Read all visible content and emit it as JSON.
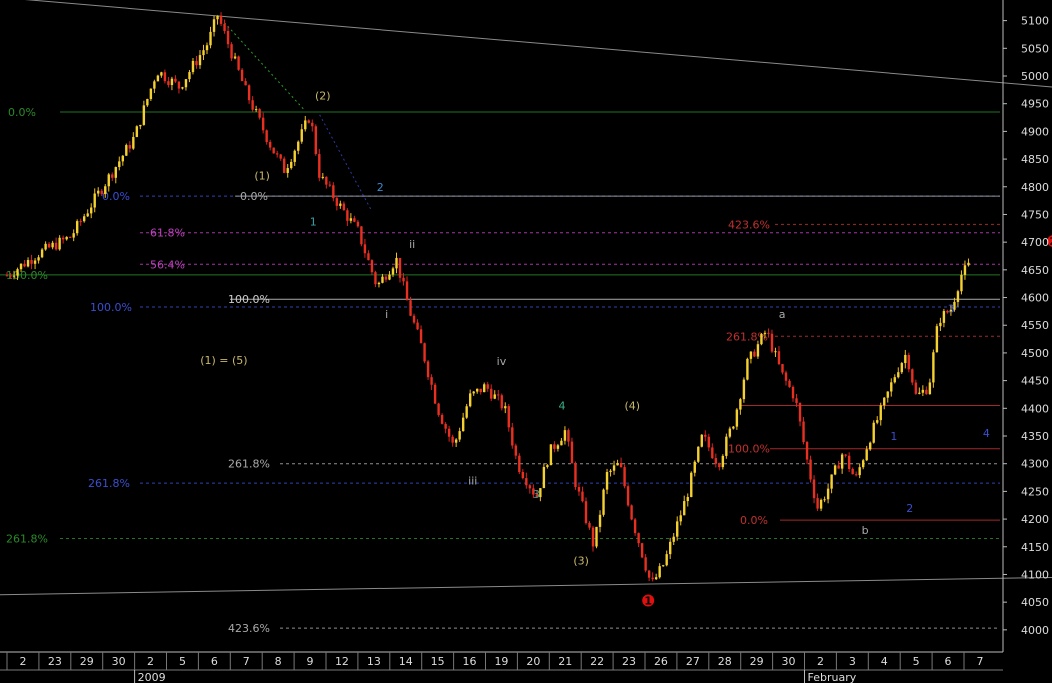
{
  "chart_data": {
    "type": "candlestick",
    "yaxis": {
      "ylim": [
        3960,
        5130
      ],
      "ticks": [
        4000,
        4050,
        4100,
        4150,
        4200,
        4250,
        4300,
        4350,
        4400,
        4450,
        4500,
        4550,
        4600,
        4650,
        4700,
        4750,
        4800,
        4850,
        4900,
        4950,
        5000,
        5050,
        5100
      ],
      "tick_labels": [
        "4000",
        "4050",
        "4100",
        "4150",
        "4200",
        "4250",
        "4300",
        "4350",
        "4400",
        "4450",
        "4500",
        "4550",
        "4600",
        "4650",
        "4700",
        "4750",
        "4800",
        "4850",
        "4900",
        "4950",
        "5000",
        "5050",
        "5100"
      ]
    },
    "xaxis": {
      "days": [
        "2",
        "23",
        "29",
        "30",
        "2",
        "5",
        "6",
        "7",
        "8",
        "9",
        "12",
        "13",
        "14",
        "15",
        "16",
        "19",
        "20",
        "21",
        "22",
        "23",
        "26",
        "27",
        "28",
        "29",
        "30",
        "2",
        "3",
        "4",
        "5",
        "6",
        "7"
      ],
      "months": [
        "2009",
        "February"
      ],
      "month_start_day_index": [
        4,
        25
      ]
    },
    "price_path": [
      [
        0,
        4640
      ],
      [
        1,
        4680
      ],
      [
        2,
        4710
      ],
      [
        3,
        4800
      ],
      [
        4,
        4890
      ],
      [
        4.7,
        5010
      ],
      [
        5.4,
        4980
      ],
      [
        6.3,
        5060
      ],
      [
        6.6,
        5110
      ],
      [
        7.5,
        4970
      ],
      [
        8.3,
        4870
      ],
      [
        8.7,
        4830
      ],
      [
        9.2,
        4890
      ],
      [
        9.5,
        4930
      ],
      [
        9.8,
        4820
      ],
      [
        10.5,
        4760
      ],
      [
        11,
        4720
      ],
      [
        11.6,
        4620
      ],
      [
        12.2,
        4670
      ],
      [
        12.6,
        4580
      ],
      [
        13,
        4510
      ],
      [
        13.5,
        4400
      ],
      [
        14,
        4330
      ],
      [
        14.5,
        4420
      ],
      [
        15,
        4440
      ],
      [
        15.6,
        4400
      ],
      [
        16,
        4300
      ],
      [
        16.6,
        4240
      ],
      [
        17,
        4320
      ],
      [
        17.5,
        4360
      ],
      [
        17.8,
        4270
      ],
      [
        18.4,
        4150
      ],
      [
        18.8,
        4280
      ],
      [
        19.2,
        4300
      ],
      [
        19.6,
        4200
      ],
      [
        20.2,
        4080
      ],
      [
        20.6,
        4120
      ],
      [
        21.3,
        4240
      ],
      [
        21.8,
        4350
      ],
      [
        22.3,
        4300
      ],
      [
        22.8,
        4380
      ],
      [
        23.2,
        4480
      ],
      [
        23.8,
        4540
      ],
      [
        24.3,
        4460
      ],
      [
        24.7,
        4420
      ],
      [
        25.1,
        4300
      ],
      [
        25.4,
        4220
      ],
      [
        25.7,
        4250
      ],
      [
        26.2,
        4320
      ],
      [
        26.6,
        4270
      ],
      [
        27,
        4340
      ],
      [
        27.5,
        4410
      ],
      [
        27.9,
        4470
      ],
      [
        28.2,
        4500
      ],
      [
        28.5,
        4420
      ],
      [
        28.9,
        4440
      ],
      [
        29.2,
        4560
      ],
      [
        29.6,
        4580
      ],
      [
        29.9,
        4640
      ],
      [
        30.2,
        4660
      ]
    ],
    "trend_lines": [
      {
        "from": [
          -3.9,
          5160
        ],
        "to": [
          32.8,
          4980
        ]
      },
      {
        "from": [
          -3.9,
          4060
        ],
        "to": [
          33.2,
          4095
        ]
      }
    ],
    "dotted_lines": [
      {
        "from": [
          6.6,
          5110
        ],
        "to": [
          9.3,
          4940
        ]
      },
      {
        "from": [
          9.8,
          4930
        ],
        "to": [
          11.4,
          4760
        ]
      }
    ],
    "fib_levels": [
      {
        "label": "0.0%",
        "value": 4935,
        "color": "#2a8a2a"
      },
      {
        "label": "0.0%",
        "value": 4783,
        "color": "#3a4fd0"
      },
      {
        "label": "0.0%",
        "value": 4783,
        "color": "#aaaaaa"
      },
      {
        "label": "423.6%",
        "value": 4732,
        "color": "#c03030"
      },
      {
        "label": "61.8%",
        "value": 4717,
        "color": "#c040c0"
      },
      {
        "label": "56.4%",
        "value": 4660,
        "color": "#c040c0"
      },
      {
        "label": "100.0%",
        "value": 4641,
        "color": "#2a8a2a"
      },
      {
        "label": "100.0%",
        "value": 4597,
        "color": "#cccccc"
      },
      {
        "label": "100.0%",
        "value": 4583,
        "color": "#3a4fd0"
      },
      {
        "label": "261.8%",
        "value": 4530,
        "color": "#c03030"
      },
      {
        "label": "",
        "value": 4405,
        "color": "#c03030"
      },
      {
        "label": "100.0%",
        "value": 4327,
        "color": "#c03030"
      },
      {
        "label": "261.8%",
        "value": 4300,
        "color": "#aaaaaa"
      },
      {
        "label": "261.8%",
        "value": 4265,
        "color": "#3a4fd0"
      },
      {
        "label": "0.0%",
        "value": 4198,
        "color": "#c03030"
      },
      {
        "label": "261.8%",
        "value": 4165,
        "color": "#2a8a2a"
      },
      {
        "label": "423.6%",
        "value": 4003,
        "color": "#aaaaaa"
      }
    ],
    "wave_labels": [
      {
        "text": "(2)",
        "x": 9.9,
        "y": 4965,
        "color": "#c8b86a"
      },
      {
        "text": "(1)",
        "x": 8.0,
        "y": 4820,
        "color": "#c8b86a"
      },
      {
        "text": "2",
        "x": 11.7,
        "y": 4800,
        "color": "#3a8acc"
      },
      {
        "text": "1",
        "x": 9.6,
        "y": 4737,
        "color": "#3aa0a0"
      },
      {
        "text": "ii",
        "x": 12.7,
        "y": 4697,
        "color": "#aaaaaa"
      },
      {
        "text": "i",
        "x": 11.9,
        "y": 4570,
        "color": "#aaaaaa"
      },
      {
        "text": "(1) = (5)",
        "x": 6.8,
        "y": 4487,
        "color": "#c8b86a"
      },
      {
        "text": "iv",
        "x": 15.5,
        "y": 4485,
        "color": "#aaaaaa"
      },
      {
        "text": "4",
        "x": 17.4,
        "y": 4405,
        "color": "#3ab08a"
      },
      {
        "text": "(4)",
        "x": 19.6,
        "y": 4405,
        "color": "#c8b86a"
      },
      {
        "text": "iii",
        "x": 14.6,
        "y": 4270,
        "color": "#aaaaaa"
      },
      {
        "text": "3",
        "x": 16.6,
        "y": 4245,
        "color": "#3aa0a0"
      },
      {
        "text": "(3)",
        "x": 18.0,
        "y": 4125,
        "color": "#c8b86a"
      },
      {
        "text": "a",
        "x": 24.3,
        "y": 4570,
        "color": "#aaaaaa"
      },
      {
        "text": "3",
        "x": 29.6,
        "y": 4580,
        "color": "#3a4fd0"
      },
      {
        "text": "4",
        "x": 30.7,
        "y": 4355,
        "color": "#3a4fd0"
      },
      {
        "text": "1",
        "x": 27.8,
        "y": 4350,
        "color": "#3a4fd0"
      },
      {
        "text": "2",
        "x": 28.3,
        "y": 4220,
        "color": "#3a4fd0"
      },
      {
        "text": "b",
        "x": 26.9,
        "y": 4180,
        "color": "#aaaaaa"
      }
    ],
    "markers": [
      {
        "text": "1",
        "x": 20.1,
        "y": 4053,
        "color": "#e01010"
      },
      {
        "text": "2",
        "x": 32.8,
        "y": 4702,
        "color": "#e01010"
      }
    ]
  }
}
